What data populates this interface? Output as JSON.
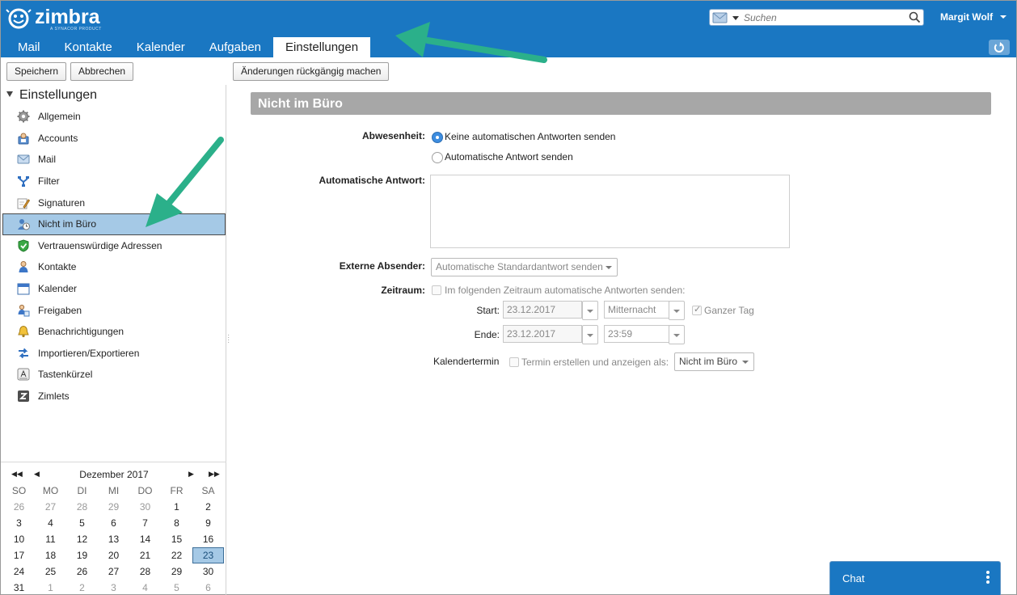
{
  "brand": {
    "name": "zimbra",
    "tagline": "A SYNACOR PRODUCT",
    "color": "#1a77c2"
  },
  "search": {
    "placeholder": "Suchen"
  },
  "user": {
    "name": "Margit Wolf"
  },
  "tabs": [
    {
      "label": "Mail"
    },
    {
      "label": "Kontakte"
    },
    {
      "label": "Kalender"
    },
    {
      "label": "Aufgaben"
    },
    {
      "label": "Einstellungen",
      "active": true
    }
  ],
  "toolbar": {
    "save_label": "Speichern",
    "cancel_label": "Abbrechen",
    "undo_label": "Änderungen rückgängig machen"
  },
  "sidebar": {
    "header": "Einstellungen",
    "items": [
      {
        "label": "Allgemein",
        "icon": "gear-icon"
      },
      {
        "label": "Accounts",
        "icon": "accounts-icon"
      },
      {
        "label": "Mail",
        "icon": "envelope-icon"
      },
      {
        "label": "Filter",
        "icon": "filter-icon"
      },
      {
        "label": "Signaturen",
        "icon": "signature-icon"
      },
      {
        "label": "Nicht im Büro",
        "icon": "out-of-office-icon",
        "selected": true
      },
      {
        "label": "Vertrauenswürdige Adressen",
        "icon": "shield-check-icon"
      },
      {
        "label": "Kontakte",
        "icon": "person-icon"
      },
      {
        "label": "Kalender",
        "icon": "calendar-icon"
      },
      {
        "label": "Freigaben",
        "icon": "sharing-icon"
      },
      {
        "label": "Benachrichtigungen",
        "icon": "bell-icon"
      },
      {
        "label": "Importieren/Exportieren",
        "icon": "import-export-icon"
      },
      {
        "label": "Tastenkürzel",
        "icon": "keyboard-icon"
      },
      {
        "label": "Zimlets",
        "icon": "zimlet-icon"
      }
    ]
  },
  "calendar": {
    "month": "Dezember 2017",
    "weekdays": [
      "SO",
      "MO",
      "DI",
      "MI",
      "DO",
      "FR",
      "SA"
    ],
    "weeks": [
      [
        [
          "26",
          true
        ],
        [
          "27",
          true
        ],
        [
          "28",
          true
        ],
        [
          "29",
          true
        ],
        [
          "30",
          true
        ],
        [
          "1",
          false
        ],
        [
          "2",
          false
        ]
      ],
      [
        [
          "3",
          false
        ],
        [
          "4",
          false
        ],
        [
          "5",
          false
        ],
        [
          "6",
          false
        ],
        [
          "7",
          false
        ],
        [
          "8",
          false
        ],
        [
          "9",
          false
        ]
      ],
      [
        [
          "10",
          false
        ],
        [
          "11",
          false
        ],
        [
          "12",
          false
        ],
        [
          "13",
          false
        ],
        [
          "14",
          false
        ],
        [
          "15",
          false
        ],
        [
          "16",
          false
        ]
      ],
      [
        [
          "17",
          false
        ],
        [
          "18",
          false
        ],
        [
          "19",
          false
        ],
        [
          "20",
          false
        ],
        [
          "21",
          false
        ],
        [
          "22",
          false
        ],
        [
          "23",
          false
        ]
      ],
      [
        [
          "24",
          false
        ],
        [
          "25",
          false
        ],
        [
          "26",
          false
        ],
        [
          "27",
          false
        ],
        [
          "28",
          false
        ],
        [
          "29",
          false
        ],
        [
          "30",
          false
        ]
      ],
      [
        [
          "31",
          false
        ],
        [
          "1",
          true
        ],
        [
          "2",
          true
        ],
        [
          "3",
          true
        ],
        [
          "4",
          true
        ],
        [
          "5",
          true
        ],
        [
          "6",
          true
        ]
      ]
    ],
    "today": "23"
  },
  "main": {
    "title": "Nicht im Büro",
    "away_label": "Abwesenheit:",
    "option_no_reply": "Keine automatischen Antworten senden",
    "option_auto_reply": "Automatische Antwort senden",
    "auto_reply_label": "Automatische Antwort:",
    "external_label": "Externe Absender:",
    "external_value": "Automatische Standardantwort senden",
    "period_label": "Zeitraum:",
    "period_check_label": "Im folgenden Zeitraum automatische Antworten senden:",
    "start_label": "Start:",
    "start_date": "23.12.2017",
    "start_time": "Mitternacht",
    "all_day_label": "Ganzer Tag",
    "end_label": "Ende:",
    "end_date": "23.12.2017",
    "end_time": "23:59",
    "cal_entry_label": "Kalendertermin",
    "cal_entry_check_label": "Termin erstellen und anzeigen als:",
    "cal_entry_value": "Nicht im Büro"
  },
  "chat": {
    "label": "Chat"
  },
  "annotation_color": "#2bb08a"
}
